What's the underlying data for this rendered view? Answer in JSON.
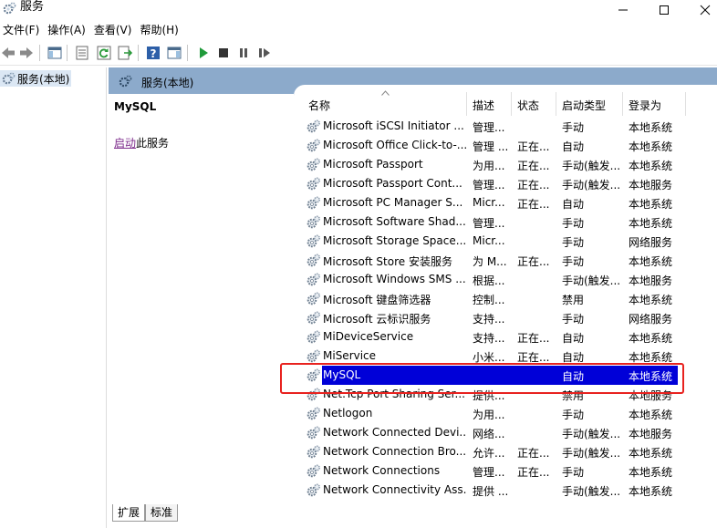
{
  "window": {
    "title": "服务"
  },
  "menu": [
    "文件(F)",
    "操作(A)",
    "查看(V)",
    "帮助(H)"
  ],
  "tree": {
    "item_label": "服务(本地)"
  },
  "pane": {
    "header_label": "服务(本地)",
    "detail_title": "MySQL",
    "action_link": "启动",
    "action_suffix": "此服务"
  },
  "columns": {
    "name": "名称",
    "desc": "描述",
    "status": "状态",
    "start": "启动类型",
    "logon": "登录为"
  },
  "rows": [
    {
      "name": "Microsoft iSCSI Initiator ...",
      "desc": "管理...",
      "status": "",
      "start": "手动",
      "logon": "本地系统"
    },
    {
      "name": "Microsoft Office Click-to-...",
      "desc": "管理 ...",
      "status": "正在...",
      "start": "自动",
      "logon": "本地系统"
    },
    {
      "name": "Microsoft Passport",
      "desc": "为用...",
      "status": "正在...",
      "start": "手动(触发...",
      "logon": "本地系统"
    },
    {
      "name": "Microsoft Passport Cont...",
      "desc": "管理...",
      "status": "正在...",
      "start": "手动(触发...",
      "logon": "本地服务"
    },
    {
      "name": "Microsoft PC Manager S...",
      "desc": "Micr...",
      "status": "正在...",
      "start": "自动",
      "logon": "本地系统"
    },
    {
      "name": "Microsoft Software Shad...",
      "desc": "管理...",
      "status": "",
      "start": "手动",
      "logon": "本地系统"
    },
    {
      "name": "Microsoft Storage Space...",
      "desc": "Micr...",
      "status": "",
      "start": "手动",
      "logon": "网络服务"
    },
    {
      "name": "Microsoft Store 安装服务",
      "desc": "为 M...",
      "status": "正在...",
      "start": "手动",
      "logon": "本地系统"
    },
    {
      "name": "Microsoft Windows SMS ...",
      "desc": "根据...",
      "status": "",
      "start": "手动(触发...",
      "logon": "本地服务"
    },
    {
      "name": "Microsoft 键盘筛选器",
      "desc": "控制...",
      "status": "",
      "start": "禁用",
      "logon": "本地系统"
    },
    {
      "name": "Microsoft 云标识服务",
      "desc": "支持...",
      "status": "",
      "start": "手动",
      "logon": "网络服务"
    },
    {
      "name": "MiDeviceService",
      "desc": "支持...",
      "status": "正在...",
      "start": "自动",
      "logon": "本地系统"
    },
    {
      "name": "MiService",
      "desc": "小米...",
      "status": "正在...",
      "start": "自动",
      "logon": "本地系统"
    },
    {
      "name": "MySQL",
      "desc": "",
      "status": "",
      "start": "自动",
      "logon": "本地系统"
    },
    {
      "name": "Net.Tcp Port Sharing Ser...",
      "desc": "提供...",
      "status": "",
      "start": "禁用",
      "logon": "本地服务"
    },
    {
      "name": "Netlogon",
      "desc": "为用...",
      "status": "",
      "start": "手动",
      "logon": "本地系统"
    },
    {
      "name": "Network Connected Devi...",
      "desc": "网络...",
      "status": "",
      "start": "手动(触发...",
      "logon": "本地服务"
    },
    {
      "name": "Network Connection Bro...",
      "desc": "允许...",
      "status": "正在...",
      "start": "手动(触发...",
      "logon": "本地系统"
    },
    {
      "name": "Network Connections",
      "desc": "管理...",
      "status": "正在...",
      "start": "手动",
      "logon": "本地系统"
    },
    {
      "name": "Network Connectivity Ass...",
      "desc": "提供 ...",
      "status": "",
      "start": "手动(触发...",
      "logon": "本地系统"
    }
  ],
  "selected_index": 13,
  "tabs": {
    "extended": "扩展",
    "standard": "标准"
  },
  "colors": {
    "header_blue": "#8caacb",
    "selection_blue": "#0000d8",
    "highlight_red": "#e8221f",
    "link_purple": "#7d2c8c"
  }
}
